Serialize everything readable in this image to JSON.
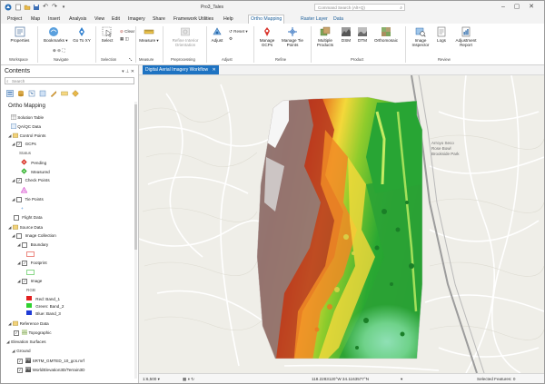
{
  "window": {
    "file_name": "Pro3_Tales",
    "search_placeholder": "Command Search (Alt+Q)",
    "icons": [
      "folder-open-icon",
      "save-icon",
      "undo-icon",
      "redo-icon",
      "minimize-icon",
      "maximize-icon",
      "close-icon"
    ]
  },
  "menu": {
    "tabs": [
      "Project",
      "Map",
      "Insert",
      "Analysis",
      "View",
      "Edit",
      "Imagery",
      "Share",
      "Framework Utilities",
      "Help",
      "Ortho Mapping",
      "Raster Layer",
      "Data"
    ],
    "active_tab": "Ortho Mapping"
  },
  "ribbon": {
    "properties": "Properties",
    "bookmarks": "Bookmarks",
    "goto": "Go To XY",
    "select": "Select",
    "clear": "Clear",
    "measure": "Measure",
    "refine": "Refine Interior Orientation",
    "adjust": "Adjust",
    "reset": "Reset",
    "manage_gcps": "Manage GCPs",
    "manage_tie": "Manage Tie Points",
    "multiple_products": "Multiple Products",
    "dsm": "DSM",
    "dtm": "DTM",
    "orthomosaic": "Orthomosaic",
    "image_inspector": "Image Inspector",
    "logs": "Logs",
    "adjustment_report": "Adjustment Report",
    "groups": {
      "workspace": "Workspace",
      "navigate": "Navigate",
      "selection": "Selection",
      "measure": "Measure",
      "preprocessing": "Preprocessing",
      "adjust": "Adjust",
      "refine": "Refine",
      "product": "Product",
      "review": "Review"
    }
  },
  "contents": {
    "title": "Contents",
    "search_placeholder": "Search",
    "tree": {
      "root": "Ortho Mapping",
      "solution_table": "Solution Table",
      "qa_qc": "QA/QC Data",
      "control_points": "Control Points",
      "gcps": "GCPs",
      "status": "Status",
      "pending": "Pending",
      "measured": "Measured",
      "check_points": "Check Points",
      "tie_points": "Tie Points",
      "flight_data": "Flight Data",
      "source_data": "Source Data",
      "image_collection": "Image Collection",
      "boundary": "Boundary",
      "footprint": "Footprint",
      "image": "Image",
      "rgb": "RGB",
      "red": "Red: Band_1",
      "green": "Green: Band_2",
      "blue": "Blue: Band_3",
      "reference_data": "Reference Data",
      "topographic": "Topographic",
      "elevation_surfaces": "Elevation Surfaces",
      "ground": "Ground",
      "srtm": "SRTM_GMTED_10_gcs.mrf",
      "world_elevation": "WorldElevation3D/Terrain3D"
    }
  },
  "map": {
    "tab_title": "Digital Aerial Imagery Workflow",
    "scale": "1:6,500",
    "coords": "118.2283120°W 34.1163577°N",
    "selected_features": "Selected Features: 0",
    "map_labels": [
      "Arroyo Seco",
      "Rose Bowl",
      "Brookside Park"
    ]
  }
}
